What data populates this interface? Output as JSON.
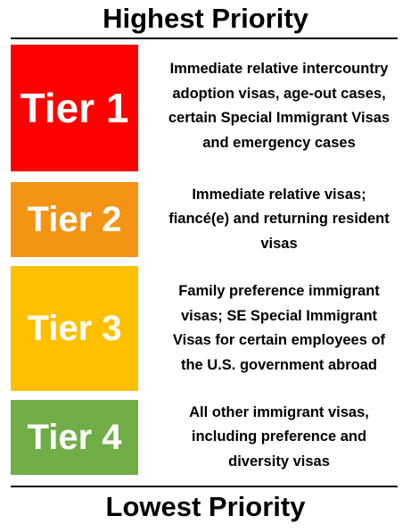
{
  "top_heading": "Highest Priority",
  "bottom_heading": "Lowest Priority",
  "colors": {
    "tier_1": "#ff0000",
    "tier_2": "#f39414",
    "tier_3": "#ffc000",
    "tier_4": "#70ad47",
    "label_text": "#ffffff"
  },
  "tiers": [
    {
      "label": "Tier 1",
      "description": "Immediate relative intercountry adoption visas, age-out cases, certain Special Immigrant Visas and emergency cases"
    },
    {
      "label": "Tier 2",
      "description": "Immediate relative visas; fiancé(e) and returning resident visas"
    },
    {
      "label": "Tier 3",
      "description": "Family preference immigrant visas; SE Special Immigrant Visas for certain employees of the U.S. government abroad"
    },
    {
      "label": "Tier 4",
      "description": "All other immigrant visas, including preference and diversity visas"
    }
  ]
}
